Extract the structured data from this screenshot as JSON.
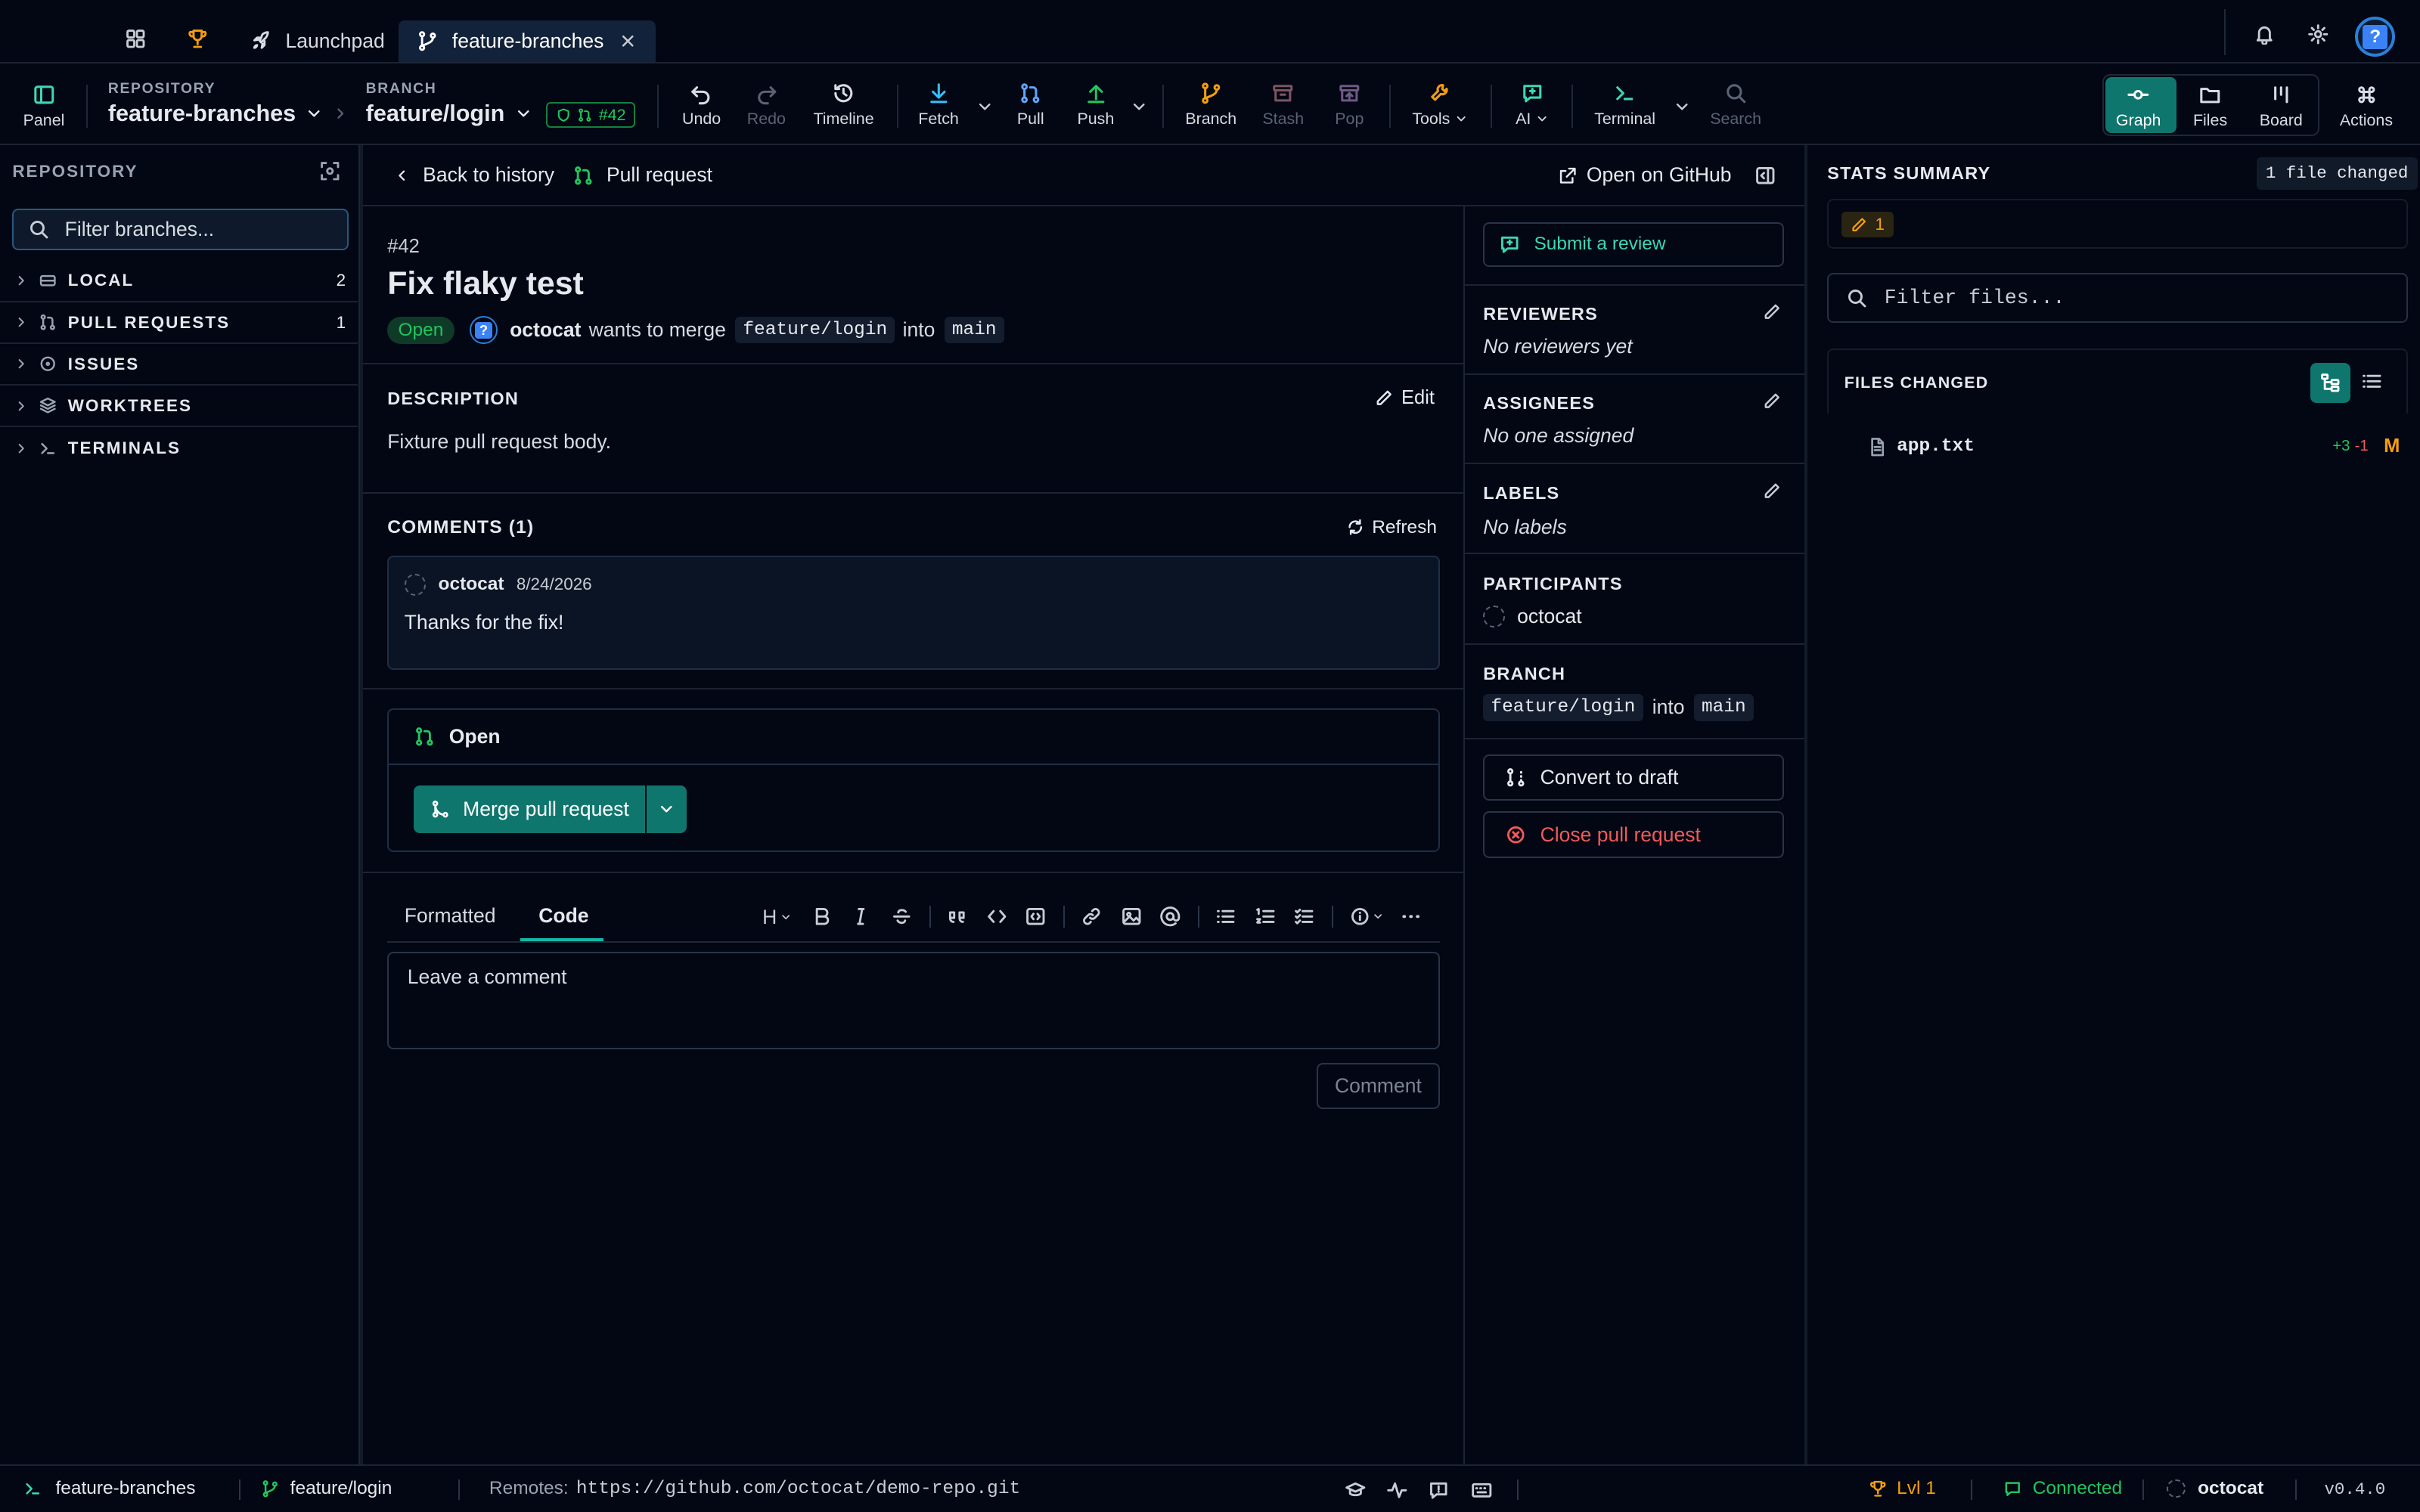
{
  "tabs": {
    "launchpad": "Launchpad",
    "active": "feature-branches"
  },
  "toolbar": {
    "panel": "Panel",
    "repo_label": "REPOSITORY",
    "repo_name": "feature-branches",
    "branch_label": "BRANCH",
    "branch_name": "feature/login",
    "pr_badge": "#42",
    "undo": "Undo",
    "redo": "Redo",
    "timeline": "Timeline",
    "fetch": "Fetch",
    "pull": "Pull",
    "push": "Push",
    "branch": "Branch",
    "stash": "Stash",
    "pop": "Pop",
    "tools": "Tools",
    "ai": "AI",
    "terminal": "Terminal",
    "search": "Search",
    "graph": "Graph",
    "files": "Files",
    "board": "Board",
    "actions": "Actions"
  },
  "sidebar": {
    "title": "REPOSITORY",
    "filter_placeholder": "Filter branches...",
    "sections": [
      {
        "label": "LOCAL",
        "count": "2"
      },
      {
        "label": "PULL REQUESTS",
        "count": "1"
      },
      {
        "label": "ISSUES",
        "count": ""
      },
      {
        "label": "WORKTREES",
        "count": ""
      },
      {
        "label": "TERMINALS",
        "count": ""
      }
    ]
  },
  "pr": {
    "back": "Back to history",
    "header_title": "Pull request",
    "open_github": "Open on GitHub",
    "number": "#42",
    "title": "Fix flaky test",
    "state": "Open",
    "author": "octocat",
    "merge_text": "wants to merge",
    "head": "feature/login",
    "into": "into",
    "base": "main",
    "description_label": "DESCRIPTION",
    "edit": "Edit",
    "description": "Fixture pull request body.",
    "comments_label": "COMMENTS (1)",
    "refresh": "Refresh",
    "comment": {
      "author": "octocat",
      "date": "8/24/2026",
      "body": "Thanks for the fix!"
    },
    "merge_state": "Open",
    "merge_button": "Merge pull request",
    "editor_tabs": {
      "formatted": "Formatted",
      "code": "Code"
    },
    "comment_placeholder": "Leave a comment",
    "comment_button": "Comment"
  },
  "details": {
    "submit_review": "Submit a review",
    "reviewers_label": "REVIEWERS",
    "reviewers_value": "No reviewers yet",
    "assignees_label": "ASSIGNEES",
    "assignees_value": "No one assigned",
    "labels_label": "LABELS",
    "labels_value": "No labels",
    "participants_label": "PARTICIPANTS",
    "participant": "octocat",
    "branch_label": "BRANCH",
    "head": "feature/login",
    "into": "into",
    "base": "main",
    "convert_draft": "Convert to draft",
    "close_pr": "Close pull request"
  },
  "rightpanel": {
    "stats_label": "STATS SUMMARY",
    "files_changed_badge": "1 file changed",
    "modified_count": "1",
    "filter_placeholder": "Filter files...",
    "files_changed_label": "FILES CHANGED",
    "files": [
      {
        "name": "app.txt",
        "additions": "+3",
        "deletions": "-1",
        "status": "M"
      }
    ]
  },
  "statusbar": {
    "repo": "feature-branches",
    "branch": "feature/login",
    "remotes_label": "Remotes:",
    "remote_url": "https://github.com/octocat/demo-repo.git",
    "level": "Lvl 1",
    "connection": "Connected",
    "user": "octocat",
    "version": "v0.4.0"
  },
  "colors": {
    "accent": "#0f766e",
    "green": "#22c55e",
    "red": "#f05a5a",
    "orange": "#f59e0b",
    "teal_text": "#3fd6b3"
  }
}
